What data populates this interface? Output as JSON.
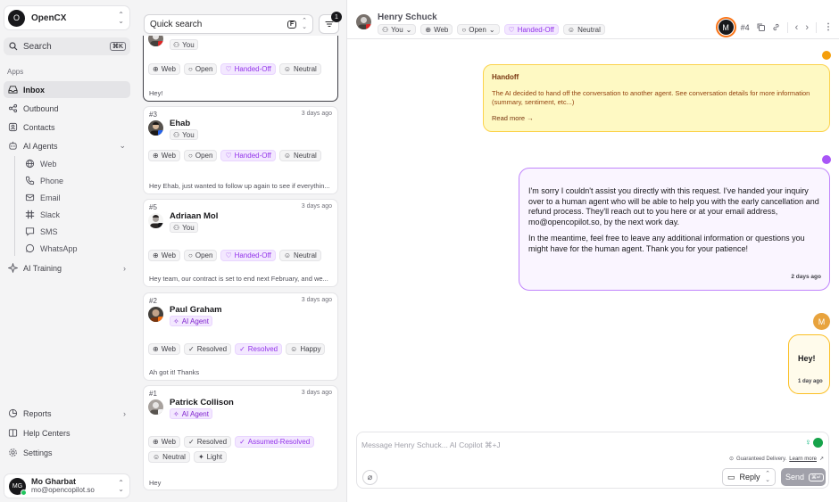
{
  "workspace": {
    "initial": "O",
    "name": "OpenCX"
  },
  "search": {
    "label": "Search",
    "shortcut": "⌘K"
  },
  "sidebar": {
    "section": "Apps",
    "items": [
      {
        "label": "Inbox",
        "icon": "inbox-icon"
      },
      {
        "label": "Outbound",
        "icon": "outbound-icon"
      },
      {
        "label": "Contacts",
        "icon": "contacts-icon"
      },
      {
        "label": "AI Agents",
        "icon": "ai-agents-icon"
      },
      {
        "label": "AI Training",
        "icon": "ai-training-icon"
      }
    ],
    "channels": [
      {
        "label": "Web",
        "icon": "globe-icon"
      },
      {
        "label": "Phone",
        "icon": "phone-icon"
      },
      {
        "label": "Email",
        "icon": "mail-icon"
      },
      {
        "label": "Slack",
        "icon": "slack-icon"
      },
      {
        "label": "SMS",
        "icon": "sms-icon"
      },
      {
        "label": "WhatsApp",
        "icon": "whatsapp-icon"
      }
    ],
    "bottom": [
      {
        "label": "Reports",
        "icon": "reports-icon"
      },
      {
        "label": "Help Centers",
        "icon": "help-centers-icon"
      },
      {
        "label": "Settings",
        "icon": "settings-icon"
      }
    ]
  },
  "user": {
    "initials": "MG",
    "name": "Mo Gharbat",
    "email": "mo@opencopilot.so"
  },
  "list": {
    "search_label": "Quick search",
    "search_key": "F",
    "filter_count": "1",
    "cards": [
      {
        "id": "",
        "time": "",
        "name": "",
        "assignee": "You",
        "tags": [
          "Web",
          "Open",
          "Handed-Off",
          "Neutral"
        ],
        "preview": "Hey!"
      },
      {
        "id": "#3",
        "time": "3 days ago",
        "name": "Ehab",
        "assignee": "You",
        "tags": [
          "Web",
          "Open",
          "Handed-Off",
          "Neutral"
        ],
        "preview": "Hey Ehab, just wanted to follow up again to see if everythin..."
      },
      {
        "id": "#5",
        "time": "3 days ago",
        "name": "Adriaan Mol",
        "assignee": "You",
        "tags": [
          "Web",
          "Open",
          "Handed-Off",
          "Neutral"
        ],
        "preview": "Hey team, our contract is set to end next February, and we..."
      },
      {
        "id": "#2",
        "time": "3 days ago",
        "name": "Paul Graham",
        "assignee": "AI Agent",
        "tags": [
          "Web",
          "Resolved",
          "Resolved",
          "Happy"
        ],
        "preview": "Ah got it! Thanks"
      },
      {
        "id": "#1",
        "time": "3 days ago",
        "name": "Patrick Collison",
        "assignee": "AI Agent",
        "tags": [
          "Web",
          "Resolved",
          "Assumed-Resolved",
          "Neutral",
          "Light"
        ],
        "preview": "Hey"
      }
    ]
  },
  "conversation": {
    "name": "Henry Schuck",
    "assignee": "You",
    "channel": "Web",
    "status": "Open",
    "handoff_state": "Handed-Off",
    "sentiment": "Neutral",
    "agent_initial": "M",
    "number": "#4",
    "handoff": {
      "title": "Handoff",
      "body": "The AI decided to hand off the conversation to another agent. See conversation details for more information (summary, sentiment, etc...)",
      "link": "Read more →"
    },
    "agent_message": {
      "p1": "I'm sorry I couldn't assist you directly with this request. I've handed your inquiry over to a human agent who will be able to help you with the early cancellation and refund process. They'll reach out to you here or at your email address, mo@opencopilot.so, by the next work day.",
      "p2": "In the meantime, feel free to leave any additional information or questions you might have for the human agent. Thank you for your patience!",
      "time": "2 days ago"
    },
    "user_message": {
      "avatar": "M",
      "text": "Hey!",
      "time": "1 day ago"
    },
    "composer": {
      "placeholder": "Message Henry Schuck... AI Copilot ⌘+J",
      "delivery": "Guaranteed Delivery.",
      "learn_more": "Learn more",
      "reply": "Reply",
      "send": "Send",
      "send_key": "⌘↵"
    }
  },
  "colors": {
    "handoff_bg": "#fef9c3",
    "agent_border": "#c084fc",
    "user_border": "#fbbf24",
    "accent_purple": "#9333ea"
  }
}
